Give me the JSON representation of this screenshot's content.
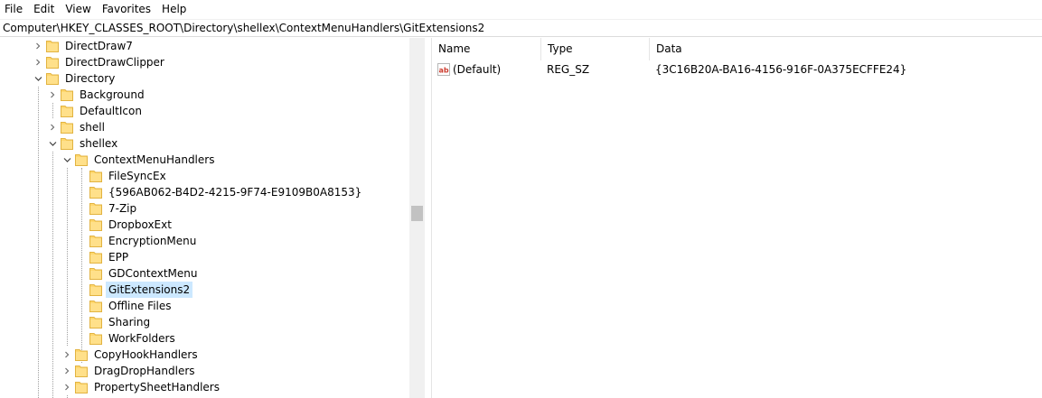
{
  "menu": [
    "File",
    "Edit",
    "View",
    "Favorites",
    "Help"
  ],
  "address": "Computer\\HKEY_CLASSES_ROOT\\Directory\\shellex\\ContextMenuHandlers\\GitExtensions2",
  "tree": [
    {
      "label": "DirectDraw7",
      "expander": "collapsed"
    },
    {
      "label": "DirectDrawClipper",
      "expander": "collapsed"
    },
    {
      "label": "Directory",
      "expander": "expanded"
    },
    {
      "label": "Background",
      "expander": "collapsed"
    },
    {
      "label": "DefaultIcon",
      "expander": "none"
    },
    {
      "label": "shell",
      "expander": "collapsed"
    },
    {
      "label": "shellex",
      "expander": "expanded"
    },
    {
      "label": "ContextMenuHandlers",
      "expander": "expanded"
    },
    {
      "label": " FileSyncEx",
      "expander": "none"
    },
    {
      "label": "{596AB062-B4D2-4215-9F74-E9109B0A8153}",
      "expander": "none"
    },
    {
      "label": "7-Zip",
      "expander": "none"
    },
    {
      "label": "DropboxExt",
      "expander": "none"
    },
    {
      "label": "EncryptionMenu",
      "expander": "none"
    },
    {
      "label": "EPP",
      "expander": "none"
    },
    {
      "label": "GDContextMenu",
      "expander": "none"
    },
    {
      "label": "GitExtensions2",
      "expander": "none",
      "selected": true
    },
    {
      "label": "Offline Files",
      "expander": "none"
    },
    {
      "label": "Sharing",
      "expander": "none"
    },
    {
      "label": "WorkFolders",
      "expander": "none"
    },
    {
      "label": "CopyHookHandlers",
      "expander": "collapsed"
    },
    {
      "label": "DragDropHandlers",
      "expander": "collapsed"
    },
    {
      "label": "PropertySheetHandlers",
      "expander": "collapsed"
    }
  ],
  "columns": {
    "name": "Name",
    "type": "Type",
    "data": "Data"
  },
  "values": [
    {
      "icon": "string-value-icon",
      "icon_text": "ab",
      "name": "(Default)",
      "type": "REG_SZ",
      "data": "{3C16B20A-BA16-4156-916F-0A375ECFFE24}"
    }
  ],
  "colors": {
    "selection": "#cce8ff",
    "folder": "#ffd76e",
    "folder_edge": "#e2b340",
    "icon_red": "#cc3b2e"
  }
}
